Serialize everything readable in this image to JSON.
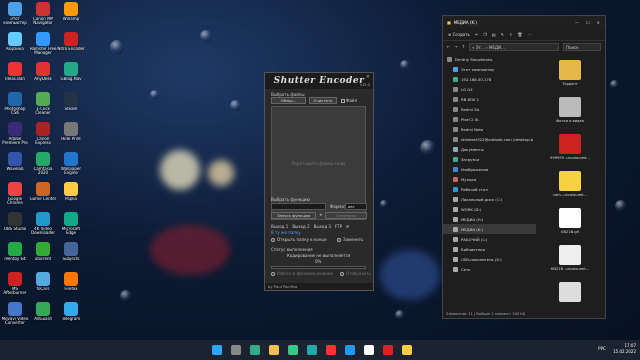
{
  "desktop": {
    "icons": [
      {
        "label": "Этот компьютер",
        "color": "#4aa3e8"
      },
      {
        "label": "Canon MP Navigator",
        "color": "#c33"
      },
      {
        "label": "Winamp",
        "color": "#f90"
      },
      {
        "label": "Корзина",
        "color": "#6cf"
      },
      {
        "label": "Hamster Free Manager",
        "color": "#39f"
      },
      {
        "label": "Nitro Encoder",
        "color": "#c22"
      },
      {
        "label": "Ideas.Ban",
        "color": "#e33"
      },
      {
        "label": "AnyDesk",
        "color": "#d33"
      },
      {
        "label": "GBlog.Nav",
        "color": "#2a8"
      },
      {
        "label": "Photoshop CS6",
        "color": "#26a"
      },
      {
        "label": "1-Click Cleaner",
        "color": "#5a5"
      },
      {
        "label": "Steam",
        "color": "#234"
      },
      {
        "label": "Adobe Premiere Pro",
        "color": "#3a2a7a"
      },
      {
        "label": "Canon Express",
        "color": "#a22"
      },
      {
        "label": "Hide Print",
        "color": "#777"
      },
      {
        "label": "Wavelab",
        "color": "#35a"
      },
      {
        "label": "Camtasia 2020",
        "color": "#2a6"
      },
      {
        "label": "Wallpaper Engine",
        "color": "#27c"
      },
      {
        "label": "Google Chrome",
        "color": "#e44"
      },
      {
        "label": "Game Center",
        "color": "#c62"
      },
      {
        "label": "Papka",
        "color": "#fc4"
      },
      {
        "label": "OBS Studio",
        "color": "#333"
      },
      {
        "label": "4K Video Downloader",
        "color": "#29c"
      },
      {
        "label": "Microsoft Edge",
        "color": "#1a8"
      },
      {
        "label": "iVentoy 64",
        "color": "#2a4"
      },
      {
        "label": "utorrent",
        "color": "#3a3"
      },
      {
        "label": "Subjects",
        "color": "#469"
      },
      {
        "label": "MS Afterburner",
        "color": "#c22"
      },
      {
        "label": "foCars",
        "color": "#5ad"
      },
      {
        "label": "Firefox",
        "color": "#f70"
      },
      {
        "label": "Movavi Video Converter",
        "color": "#47c"
      },
      {
        "label": "AdGuard",
        "color": "#3a5"
      },
      {
        "label": "Telegram",
        "color": "#3ae"
      }
    ]
  },
  "shutter": {
    "title": "Shutter Encoder",
    "version": "v15.0",
    "close": "×",
    "choose_files": "Выбрать файлы",
    "browse": "Обзор...",
    "clear": "Очистить",
    "file": "Файл",
    "drop_hint": "Перетащите файлы сюда",
    "choose_function": "Выбрать функцию",
    "format": "Формат",
    "format_value": "авт",
    "start": "Запуск функции",
    "cancel": "Отменить",
    "outputs": [
      "Выход 1",
      "Выход 2",
      "Выход 3",
      "FTP"
    ],
    "from_source": "В ту же папку",
    "open_folder": "Открыть папку в конце",
    "replace": "Заменить",
    "status_title": "Статус выполнения",
    "status_text": "Кодирование не выполняется",
    "progress": "0%",
    "background": "Работа в фоновом режиме",
    "shutdown": "Отобразить",
    "footer": "by Paul Pacifico"
  },
  "explorer": {
    "title": "МЕДИА (K:)",
    "new": "Создать",
    "addr": "« Эт... › МЕДИ...",
    "search": "Поиск",
    "nav": [
      {
        "label": "Dmitriy Stonzhenko",
        "color": "#888"
      },
      {
        "label": "Этот компьютер",
        "color": "#4aa3e8",
        "sel": false
      },
      {
        "label": "192.168.50.178",
        "color": "#4a8"
      },
      {
        "label": "LG G4",
        "color": "#888"
      },
      {
        "label": "RB BOX 2",
        "color": "#888"
      },
      {
        "label": "Redmi 5A",
        "color": "#888"
      },
      {
        "label": "Pixel 2 XL",
        "color": "#888"
      },
      {
        "label": "Redmi Note",
        "color": "#888"
      },
      {
        "label": "stridentt322@outlook.com (desktop-b",
        "color": "#888"
      },
      {
        "label": "Документы",
        "color": "#8ab"
      },
      {
        "label": "Загрузки",
        "color": "#4a8"
      },
      {
        "label": "Изображения",
        "color": "#48c"
      },
      {
        "label": "Музыка",
        "color": "#c66"
      },
      {
        "label": "Рабочий стол",
        "color": "#39c"
      },
      {
        "label": "Локальный диск (C:)",
        "color": "#aaa"
      },
      {
        "label": "WORK (D:)",
        "color": "#aaa"
      },
      {
        "label": "МЕДИА (H:)",
        "color": "#aaa"
      },
      {
        "label": "МЕДИА (K:)",
        "color": "#aaa",
        "sel": true
      },
      {
        "label": "РАБОЧИЙ (L:)",
        "color": "#aaa"
      },
      {
        "label": "Библиотеки",
        "color": "#aaa"
      },
      {
        "label": "USB-накопитель (E:)",
        "color": "#aaa"
      },
      {
        "label": "Сеть",
        "color": "#aaa"
      }
    ],
    "files": [
      {
        "label": "Торрент",
        "color": "#e6b84a"
      },
      {
        "label": "Фотки и видео",
        "color": "#bbb"
      },
      {
        "label": "999999 -uncoloured...",
        "color": "#c22"
      },
      {
        "label": "com--uncoloured...",
        "color": "#f4d240"
      },
      {
        "label": "KN21B.gif",
        "color": "#fff"
      },
      {
        "label": "KN21B -uncoloured...",
        "color": "#eee"
      },
      {
        "label": "",
        "color": "#ddd"
      }
    ],
    "status": "Элементов: 11  |  Выбран 1 элемент: 545 КБ"
  },
  "taskbar": {
    "icons": [
      "#2aa7ff",
      "#888",
      "#3a8",
      "#f7c04a",
      "#3c8",
      "#2aa",
      "#f33",
      "#29f",
      "#fff",
      "#d22",
      "#fc4"
    ],
    "lang": "РУС",
    "time": "17:07",
    "date": "15.02.2022"
  }
}
